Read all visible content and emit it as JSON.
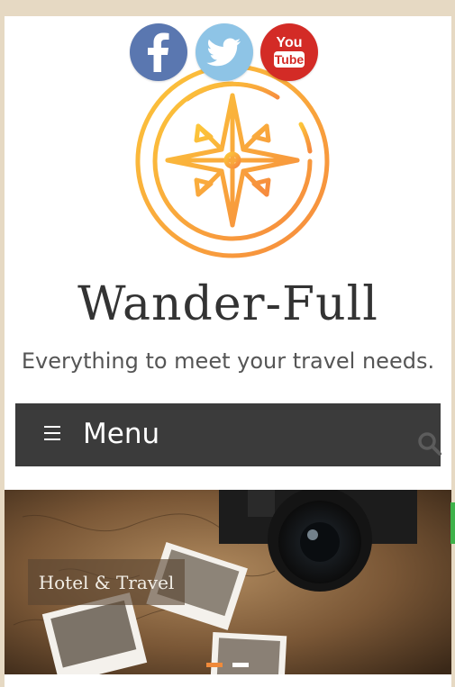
{
  "social": {
    "facebook_icon": "facebook-icon",
    "twitter_icon": "twitter-icon",
    "youtube_icon": "youtube-icon",
    "youtube_you": "You",
    "youtube_tube": "Tube"
  },
  "site": {
    "title": "Wander-Full",
    "tagline": "Everything to meet your travel needs."
  },
  "nav": {
    "menu_label": "Menu",
    "search_icon": "search-icon"
  },
  "slider": {
    "caption": "Hotel & Travel",
    "active_slide": 1,
    "slide_count": 2
  },
  "colors": {
    "page_bg": "#e6d9c3",
    "nav_bg": "#3b3b3b",
    "accent": "#f08a3a",
    "logo_gradient_start": "#fcc63a",
    "logo_gradient_end": "#f68a3e"
  }
}
